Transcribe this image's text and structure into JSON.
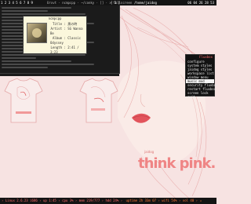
{
  "topbar": {
    "tags": "1 2 3 4 5 6 7 8 9",
    "window_title": "Urxvt · ncmpcpp · ~/conky · [] · > fullscreen",
    "workspace": "[ 3 ]",
    "path": "/home/jaidog",
    "clock": "06 04 26 28 53"
  },
  "music": {
    "title_bar": "ncmpcpp",
    "labels": {
      "title": "Title",
      "artist": "Artist",
      "album": "Album",
      "length": "Length"
    },
    "title": "黒の時",
    "artist": "SG Wanna Be",
    "album": "Classic Odyssey",
    "length": "2:41 / 3:23"
  },
  "menu": {
    "title": "Fluxbox",
    "items": [
      "configure",
      "system styles",
      "jaidog styles",
      "workspace list",
      "window menu",
      "music mod",
      "security fluxbox",
      "restart fluxbox",
      "screen lock",
      "exit"
    ],
    "selected_index": 5
  },
  "wallpaper": {
    "brand": "think pink.",
    "brand_sub": "jaidog"
  },
  "statusbar": {
    "left": "› Linux 2.6.23 i686 › up 1:45 › cpu 3% › mem 219/777 › hdd 24% › ",
    "right": "uptime 2h 33m 07 › wifi 54% › vol 40 › ◂"
  },
  "colors": {
    "accent": "#ff6c6c",
    "status": "#ff7a3a",
    "bar_bg": "#141414",
    "wallpaper_bg": "#f7e3e2"
  }
}
